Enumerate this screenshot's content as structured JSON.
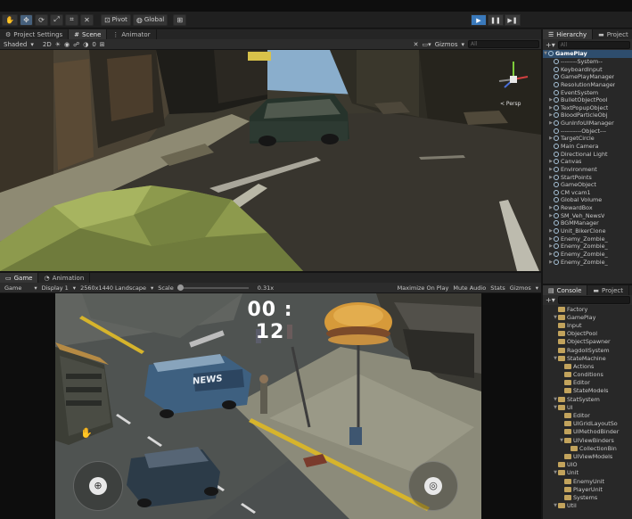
{
  "toolbar": {
    "tools": [
      "hand-tool",
      "move-tool",
      "rotate-tool",
      "scale-tool",
      "rect-tool",
      "transform-tool"
    ],
    "pivot_label": "Pivot",
    "global_label": "Global"
  },
  "scene_panel": {
    "tabs": [
      {
        "label": "Project Settings"
      },
      {
        "label": "Scene"
      },
      {
        "label": "Animator"
      }
    ],
    "draw_mode": "Shaded",
    "mode_2d": "2D",
    "fx_count": "0",
    "gizmos_label": "Gizmos",
    "search_placeholder": "All",
    "persp_label": "< Persp"
  },
  "hierarchy": {
    "tab_label": "Hierarchy",
    "project_tab_label": "Project",
    "search_placeholder": "All",
    "root": "GamePlay",
    "items": [
      {
        "name": "--------System--",
        "expandable": false
      },
      {
        "name": "KeyboardInput",
        "expandable": false
      },
      {
        "name": "GamePlayManager",
        "expandable": false
      },
      {
        "name": "ResolutionManager",
        "expandable": false
      },
      {
        "name": "EventSystem",
        "expandable": false
      },
      {
        "name": "BulletObjectPool",
        "expandable": true
      },
      {
        "name": "TextPopupObject",
        "expandable": true
      },
      {
        "name": "BloodParticleObj",
        "expandable": true
      },
      {
        "name": "GunInfoUIManager",
        "expandable": true
      },
      {
        "name": "----------Object---",
        "expandable": false
      },
      {
        "name": "TargetCircle",
        "expandable": true
      },
      {
        "name": "Main Camera",
        "expandable": false
      },
      {
        "name": "Directional Light",
        "expandable": false
      },
      {
        "name": "Canvas",
        "expandable": true
      },
      {
        "name": "Environment",
        "expandable": true
      },
      {
        "name": "StartPoints",
        "expandable": true
      },
      {
        "name": "GameObject",
        "expandable": false
      },
      {
        "name": "CM vcam1",
        "expandable": false
      },
      {
        "name": "Global Volume",
        "expandable": false
      },
      {
        "name": "RewardBox",
        "expandable": true
      },
      {
        "name": "SM_Veh_NewsV",
        "expandable": true
      },
      {
        "name": "BGMManager",
        "expandable": false
      },
      {
        "name": "Unit_BikerClone",
        "expandable": true
      },
      {
        "name": "Enemy_Zombie_",
        "expandable": true
      },
      {
        "name": "Enemy_Zombie_",
        "expandable": true
      },
      {
        "name": "Enemy_Zombie_",
        "expandable": true
      },
      {
        "name": "Enemy_Zombie_",
        "expandable": true
      }
    ]
  },
  "game_panel": {
    "tabs": [
      {
        "label": "Game"
      },
      {
        "label": "Animation"
      }
    ],
    "view_mode": "Game",
    "display": "Display 1",
    "resolution": "2560x1440 Landscape",
    "scale_label": "Scale",
    "scale_value": "0.31x",
    "scale_fraction": 0.31,
    "maximize_label": "Maximize On Play",
    "mute_label": "Mute Audio",
    "stats_label": "Stats",
    "gizmos_label": "Gizmos",
    "timer": "00 : 12",
    "news_text": "NEWS"
  },
  "project_panel": {
    "console_tab": "Console",
    "project_tab": "Project",
    "folders": [
      {
        "name": "Factory",
        "indent": 1,
        "expandable": false
      },
      {
        "name": "GamePlay",
        "indent": 1,
        "expandable": true
      },
      {
        "name": "Input",
        "indent": 1,
        "expandable": false
      },
      {
        "name": "ObjectPool",
        "indent": 1,
        "expandable": false
      },
      {
        "name": "ObjectSpawner",
        "indent": 1,
        "expandable": false
      },
      {
        "name": "RagdollSystem",
        "indent": 1,
        "expandable": false
      },
      {
        "name": "StateMachine",
        "indent": 1,
        "expandable": true
      },
      {
        "name": "Actions",
        "indent": 2,
        "expandable": false
      },
      {
        "name": "Conditions",
        "indent": 2,
        "expandable": false
      },
      {
        "name": "Editor",
        "indent": 2,
        "expandable": false
      },
      {
        "name": "StateModels",
        "indent": 2,
        "expandable": false
      },
      {
        "name": "StatSystem",
        "indent": 1,
        "expandable": true
      },
      {
        "name": "UI",
        "indent": 1,
        "expandable": true
      },
      {
        "name": "Editor",
        "indent": 2,
        "expandable": false
      },
      {
        "name": "UIGridLayoutSo",
        "indent": 2,
        "expandable": false
      },
      {
        "name": "UIMethodBinder",
        "indent": 2,
        "expandable": false
      },
      {
        "name": "UIViewBinders",
        "indent": 2,
        "expandable": true
      },
      {
        "name": "CollectionBin",
        "indent": 3,
        "expandable": false
      },
      {
        "name": "UIViewModels",
        "indent": 2,
        "expandable": false
      },
      {
        "name": "UIO",
        "indent": 1,
        "expandable": false
      },
      {
        "name": "Unit",
        "indent": 1,
        "expandable": true
      },
      {
        "name": "EnemyUnit",
        "indent": 2,
        "expandable": false
      },
      {
        "name": "PlayerUnit",
        "indent": 2,
        "expandable": false
      },
      {
        "name": "Systems",
        "indent": 2,
        "expandable": false
      },
      {
        "name": "Util",
        "indent": 1,
        "expandable": true
      }
    ]
  }
}
